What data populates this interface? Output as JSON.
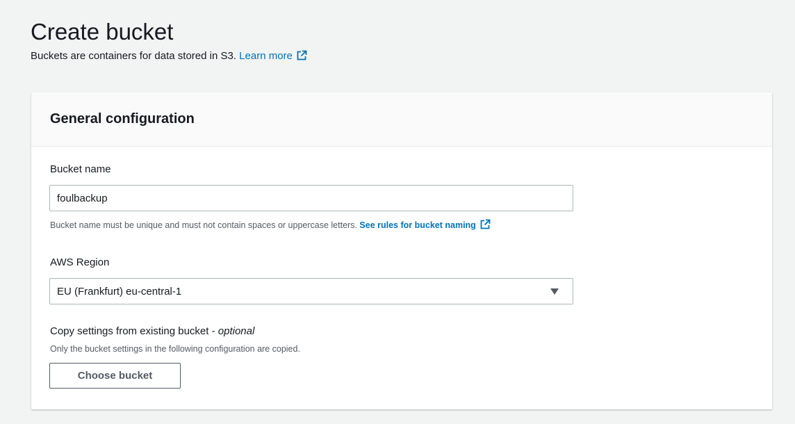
{
  "header": {
    "title": "Create bucket",
    "description": "Buckets are containers for data stored in S3.",
    "learn_more_label": "Learn more"
  },
  "panel": {
    "title": "General configuration",
    "bucket_name": {
      "label": "Bucket name",
      "value": "foulbackup",
      "hint_text": "Bucket name must be unique and must not contain spaces or uppercase letters.",
      "hint_link": "See rules for bucket naming"
    },
    "region": {
      "label": "AWS Region",
      "selected": "EU (Frankfurt) eu-central-1"
    },
    "copy_settings": {
      "label": "Copy settings from existing bucket -",
      "optional_label": "optional",
      "description": "Only the bucket settings in the following configuration are copied.",
      "button_label": "Choose bucket"
    }
  },
  "colors": {
    "link": "#0073bb",
    "background": "#f2f3f3",
    "text": "#16191f",
    "secondary_text": "#545b64",
    "border": "#aab7b8"
  },
  "icons": {
    "external_link": "external-link-icon",
    "dropdown": "caret-down-icon"
  }
}
